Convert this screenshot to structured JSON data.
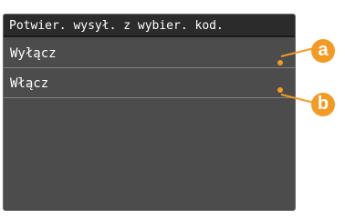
{
  "header": {
    "title": "Potwier. wysył. z wybier. kod."
  },
  "menu": {
    "items": [
      {
        "label": "Wyłącz"
      },
      {
        "label": "Włącz"
      }
    ]
  },
  "callouts": [
    {
      "letter": "a"
    },
    {
      "letter": "b"
    }
  ],
  "colors": {
    "screen_bg": "#4c4c4c",
    "header_bg": "#2b2b2b",
    "accent_callout": "#f29a24"
  }
}
